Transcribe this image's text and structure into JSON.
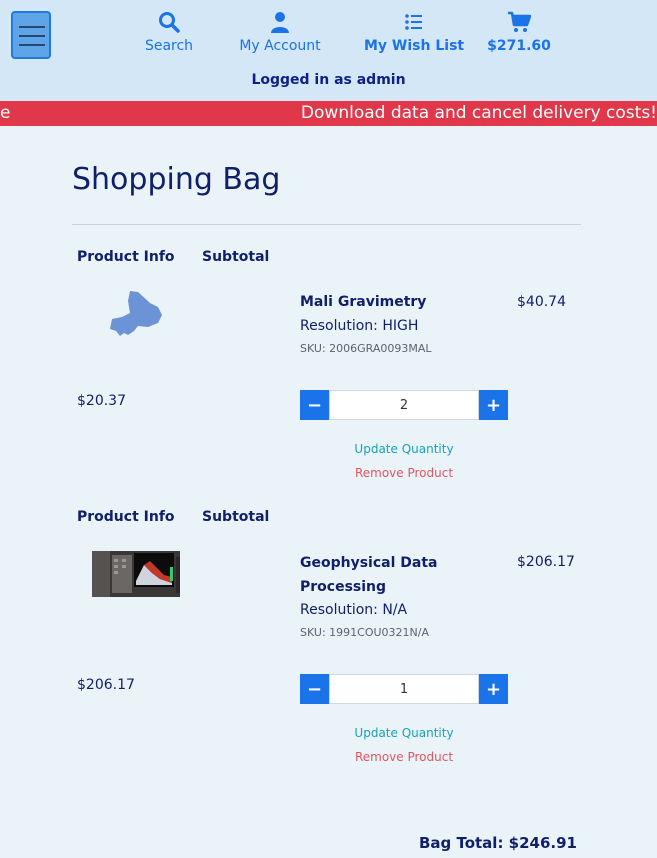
{
  "header": {
    "nav": {
      "search": "Search",
      "account": "My Account",
      "wishlist": "My Wish List",
      "cart_total": "$271.60"
    },
    "logged_in": "Logged in as admin"
  },
  "banner": {
    "left_fragment": "e",
    "message": "Download data and cancel delivery costs!"
  },
  "bag": {
    "title": "Shopping Bag",
    "col_product": "Product Info",
    "col_subtotal": "Subtotal",
    "items": [
      {
        "name": "Mali Gravimetry",
        "resolution": "Resolution: HIGH",
        "sku": "SKU: 2006GRA0093MAL",
        "line_total": "$40.74",
        "unit_price": "$20.37",
        "quantity": "2",
        "update_label": "Update Quantity",
        "remove_label": "Remove Product"
      },
      {
        "name": "Geophysical Data Processing",
        "resolution": "Resolution: N/A",
        "sku": "SKU: 1991COU0321N/A",
        "line_total": "$206.17",
        "unit_price": "$206.17",
        "quantity": "1",
        "update_label": "Update Quantity",
        "remove_label": "Remove Product"
      }
    ],
    "total": "Bag Total: $246.91"
  },
  "colors": {
    "header_bg": "#d3e7f6",
    "accent": "#1a73e8",
    "banner": "#e0384a",
    "text": "#0f1f6a"
  },
  "icons": {
    "menu": "hamburger-menu-icon",
    "search": "search-icon",
    "account": "user-icon",
    "wishlist": "list-icon",
    "cart": "cart-icon",
    "minus": "minus-icon",
    "plus": "plus-icon"
  }
}
